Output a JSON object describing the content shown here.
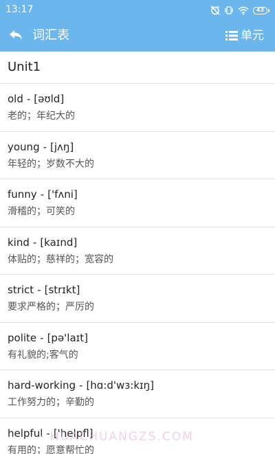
{
  "status_bar": {
    "time": "13:17",
    "battery": "43"
  },
  "app_bar": {
    "back_icon": "back-arrow-icon",
    "title": "词汇表",
    "unit_icon": "list-icon",
    "unit_label": "单元"
  },
  "section": {
    "title": "Unit1"
  },
  "words": [
    {
      "word": "old",
      "sep": "-",
      "phonetic": "[əʊld]",
      "meaning": "老的；年纪大的"
    },
    {
      "word": "young",
      "sep": "-",
      "phonetic": "[jʌŋ]",
      "meaning": "年轻的；岁数不大的"
    },
    {
      "word": "funny",
      "sep": "-",
      "phonetic": "['fʌni]",
      "meaning": "滑稽的；可笑的"
    },
    {
      "word": "kind",
      "sep": "-",
      "phonetic": "[kaɪnd]",
      "meaning": "体贴的；慈祥的；宽容的"
    },
    {
      "word": "strict",
      "sep": "-",
      "phonetic": "[strɪkt]",
      "meaning": "要求严格的；严厉的"
    },
    {
      "word": "polite",
      "sep": "-",
      "phonetic": "[pə'laɪt]",
      "meaning": "有礼貌的;客气的"
    },
    {
      "word": "hard-working",
      "sep": "-",
      "phonetic": "[hɑ:d'wɜ:kɪŋ]",
      "meaning": "工作努力的；辛勤的"
    },
    {
      "word": "helpful",
      "sep": "-",
      "phonetic": "['helpfl]",
      "meaning": "有用的；愿意帮忙的"
    }
  ],
  "watermark": "· HUACHUANGZS.COM",
  "colors": {
    "primary": "#6cb6ee",
    "divider": "#e2e2e2",
    "text": "#222222",
    "secondary_text": "#555555"
  }
}
